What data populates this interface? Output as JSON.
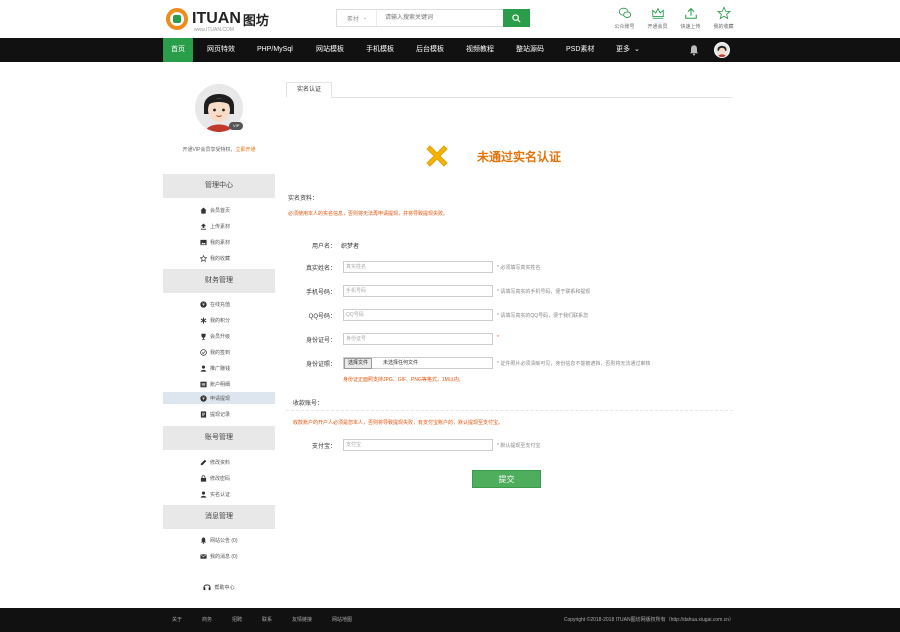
{
  "header": {
    "logo_text": "ITUAN",
    "logo_cn": "图坊",
    "logo_sub": "www.ITUAN.COM",
    "search": {
      "category": "素材",
      "placeholder": "请输入搜索关键词"
    },
    "tools": [
      {
        "label": "公众账号",
        "icon": "wechat-icon"
      },
      {
        "label": "开通会员",
        "icon": "crown-icon"
      },
      {
        "label": "快速上传",
        "icon": "upload-icon"
      },
      {
        "label": "我的收藏",
        "icon": "star-icon"
      }
    ]
  },
  "nav": {
    "items": [
      "首页",
      "网页特效",
      "PHP/MySql",
      "网站模板",
      "手机模板",
      "后台模板",
      "视频教程",
      "整站源码",
      "PSD素材",
      "更多"
    ]
  },
  "sidebar": {
    "badge": "VIP",
    "vip_text": "开通VIP会员享受特权，",
    "vip_link": "立即开通",
    "sections": [
      {
        "title": "管理中心",
        "items": [
          {
            "label": "会员首页",
            "icon": "home-icon"
          },
          {
            "label": "上传素材",
            "icon": "upload-icon"
          },
          {
            "label": "我的素材",
            "icon": "image-icon"
          },
          {
            "label": "我的收藏",
            "icon": "star-icon"
          }
        ]
      },
      {
        "title": "财务管理",
        "items": [
          {
            "label": "在线充值",
            "icon": "coin-icon"
          },
          {
            "label": "我的积分",
            "icon": "asterisk-icon"
          },
          {
            "label": "会员升级",
            "icon": "trophy-icon"
          },
          {
            "label": "我的签到",
            "icon": "check-circle-icon"
          },
          {
            "label": "推广赚钱",
            "icon": "user-icon"
          },
          {
            "label": "账户明细",
            "icon": "list-icon"
          },
          {
            "label": "申请提现",
            "icon": "coin-icon"
          },
          {
            "label": "提现记录",
            "icon": "document-icon"
          }
        ]
      },
      {
        "title": "账号管理",
        "items": [
          {
            "label": "修改资料",
            "icon": "edit-icon"
          },
          {
            "label": "修改密码",
            "icon": "lock-icon"
          },
          {
            "label": "实名认证",
            "icon": "id-icon"
          }
        ]
      },
      {
        "title": "消息管理",
        "items": [
          {
            "label": "网站公告 (0)",
            "icon": "bell-icon"
          },
          {
            "label": "我的消息 (0)",
            "icon": "mail-icon"
          }
        ]
      }
    ],
    "active_item": "申请提现",
    "help": "帮助中心"
  },
  "main": {
    "tab": "实名认证",
    "status_title": "未通过实名认证",
    "section1": "实名资料：",
    "warning1": "必须使用本人的实名信息，否则将无法再申请提现，并将导致提现失败。",
    "username_label": "用户名：",
    "username_value": "织梦者",
    "fields": [
      {
        "label": "真实姓名：",
        "placeholder": "真实姓名",
        "hint": "* 必须填写真实姓名"
      },
      {
        "label": "手机号码：",
        "placeholder": "手机号码",
        "hint": "* 请填写真实的手机号码，便于联系和提现"
      },
      {
        "label": "QQ号码：",
        "placeholder": "QQ号码",
        "hint": "* 请填写真实的QQ号码，便于我们联系您"
      },
      {
        "label": "身份证号：",
        "placeholder": "身份证号",
        "hint": "*"
      }
    ],
    "photo_label": "身份证照：",
    "file_btn": "选择文件",
    "file_name": "未选择任何文件",
    "photo_hint": "* 证件照片必须清晰可见，身份信息不能被遮挡，否则将无法通过审核",
    "photo_format": "身份证正面照支持JPG、GIF、PNG等格式，1M以内。",
    "section2": "收款账号：",
    "warning2": "收款账户的开户人必须是您本人，否则将导致提现失败，有支付宝账户的，默认提现至支付宝。",
    "alipay_label": "支付宝：",
    "alipay_placeholder": "支付宝",
    "alipay_hint": "* 默认提现至支付宝",
    "submit": "提交"
  },
  "footer": {
    "links": [
      "关于",
      "商务",
      "招聘",
      "联系",
      "友情链接",
      "网站地图"
    ],
    "copyright": "Copyright ©2018-2018 ITUAN图坊网版权所有（http://dahua.xiugai.com.cn）"
  },
  "colors": {
    "brand_green": "#2a9d4b",
    "accent_orange": "#e6730a",
    "warning_red": "#e6530a",
    "nav_bg": "#111111"
  }
}
